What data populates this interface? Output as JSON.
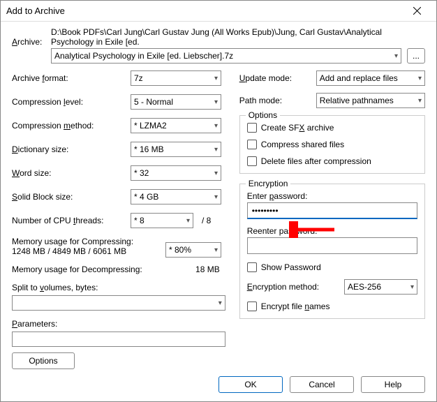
{
  "title": "Add to Archive",
  "archive": {
    "label": "Archive:",
    "path": "D:\\Book PDFs\\Carl Jung\\Carl Gustav Jung (All Works Epub)\\Jung, Carl Gustav\\Analytical Psychology in Exile [ed.",
    "filename": "Analytical Psychology in Exile [ed. Liebscher].7z",
    "browse": "..."
  },
  "left": {
    "format_label": "Archive format:",
    "format_label_u": "f",
    "format_value": "7z",
    "level_label": "Compression level:",
    "level_label_u": "l",
    "level_value": "5 - Normal",
    "method_label": "Compression method:",
    "method_label_u": "m",
    "method_value": "* LZMA2",
    "dict_label": "Dictionary size:",
    "dict_label_u": "D",
    "dict_value": "* 16 MB",
    "word_label": "Word size:",
    "word_label_u": "W",
    "word_value": "* 32",
    "block_label": "Solid Block size:",
    "block_label_u": "S",
    "block_value": "* 4 GB",
    "threads_label": "Number of CPU threads:",
    "threads_label_u": "t",
    "threads_value": "* 8",
    "threads_max": "/ 8",
    "mem_comp_label": "Memory usage for Compressing:",
    "mem_comp_value": "1248 MB / 4849 MB / 6061 MB",
    "mem_pct": "* 80%",
    "mem_decomp_label": "Memory usage for Decompressing:",
    "mem_decomp_value": "18 MB",
    "split_label": "Split to volumes, bytes:",
    "split_label_u": "v",
    "split_value": "",
    "params_label": "Parameters:",
    "params_label_u": "P",
    "params_value": "",
    "options_btn": "Options"
  },
  "right": {
    "update_label": "Update mode:",
    "update_label_u": "U",
    "update_value": "Add and replace files",
    "path_label": "Path mode:",
    "path_value": "Relative pathnames",
    "options_title": "Options",
    "sfx_label": "Create SFX archive",
    "sfx_label_u": "x",
    "shared_label": "Compress shared files",
    "delete_label": "Delete files after compression",
    "enc_title": "Encryption",
    "enter_pw_label": "Enter password:",
    "enter_pw_label_u": "p",
    "pw_value": "•••••••••",
    "reenter_pw_label": "Reenter password:",
    "reenter_pw_value": "",
    "show_pw_label": "Show Password",
    "enc_method_label": "Encryption method:",
    "enc_method_label_u": "E",
    "enc_method_value": "AES-256",
    "enc_names_label": "Encrypt file names",
    "enc_names_label_u": "n"
  },
  "buttons": {
    "ok": "OK",
    "cancel": "Cancel",
    "help": "Help"
  }
}
